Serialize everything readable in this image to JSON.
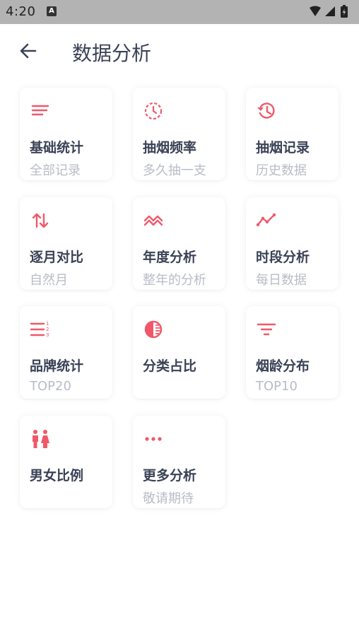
{
  "status_bar": {
    "time": "4:20",
    "app_badge": "A",
    "icons": [
      "wifi-icon",
      "cell-signal-icon",
      "battery-charging-icon"
    ]
  },
  "header": {
    "back_icon": "arrow-left-icon",
    "title": "数据分析"
  },
  "colors": {
    "accent": "#f0586a",
    "title_text": "#3a4256",
    "subtitle_text": "#b8bcc6",
    "status_bar_bg": "#b3b3b3"
  },
  "cards": [
    {
      "icon": "lines-icon",
      "title": "基础统计",
      "subtitle": "全部记录"
    },
    {
      "icon": "clock-icon",
      "title": "抽烟频率",
      "subtitle": "多久抽一支"
    },
    {
      "icon": "history-icon",
      "title": "抽烟记录",
      "subtitle": "历史数据"
    },
    {
      "icon": "swap-vertical-icon",
      "title": "逐月对比",
      "subtitle": "自然月"
    },
    {
      "icon": "zigzag-icon",
      "title": "年度分析",
      "subtitle": "整年的分析"
    },
    {
      "icon": "trend-line-icon",
      "title": "时段分析",
      "subtitle": "每日数据"
    },
    {
      "icon": "ordered-list-icon",
      "title": "品牌统计",
      "subtitle": "TOP20"
    },
    {
      "icon": "contrast-circle-icon",
      "title": "分类占比",
      "subtitle": ""
    },
    {
      "icon": "filter-icon",
      "title": "烟龄分布",
      "subtitle": "TOP10"
    },
    {
      "icon": "male-female-icon",
      "title": "男女比例",
      "subtitle": ""
    },
    {
      "icon": "more-horizontal-icon",
      "title": "更多分析",
      "subtitle": "敬请期待"
    }
  ]
}
